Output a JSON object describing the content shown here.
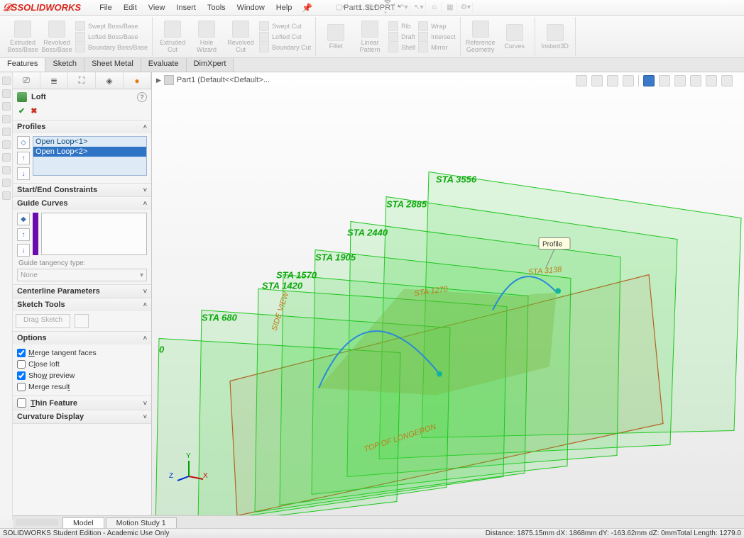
{
  "app": {
    "name": "SOLIDWORKS",
    "title": "Part1.SLDPRT *"
  },
  "menu": {
    "file": "File",
    "edit": "Edit",
    "view": "View",
    "insert": "Insert",
    "tools": "Tools",
    "window": "Window",
    "help": "Help"
  },
  "ribbon": {
    "extruded": "Extruded Boss/Base",
    "revolved": "Revolved Boss/Base",
    "swept": "Swept Boss/Base",
    "lofted": "Lofted Boss/Base",
    "boundary": "Boundary Boss/Base",
    "extrudedCut": "Extruded Cut",
    "holeWizard": "Hole Wizard",
    "revolvedCut": "Revolved Cut",
    "sweptCut": "Swept Cut",
    "loftedCut": "Lofted Cut",
    "boundaryCut": "Boundary Cut",
    "fillet": "Fillet",
    "linear": "Linear Pattern",
    "rib": "Rib",
    "draft": "Draft",
    "shell": "Shell",
    "wrap": "Wrap",
    "intersect": "Intersect",
    "mirror": "Mirror",
    "refGeom": "Reference Geometry",
    "curves": "Curves",
    "instant3d": "Instant3D"
  },
  "tabs": {
    "features": "Features",
    "sketch": "Sketch",
    "sheetMetal": "Sheet Metal",
    "evaluate": "Evaluate",
    "dimxpert": "DimXpert"
  },
  "crumb": "Part1 (Default<<Default>...",
  "feature": {
    "name": "Loft",
    "profilesHdr": "Profiles",
    "profiles": [
      "Open Loop<1>",
      "Open Loop<2>"
    ],
    "startEnd": "Start/End Constraints",
    "guideHdr": "Guide Curves",
    "gtLabel": "Guide tangency type:",
    "gtValue": "None",
    "centerline": "Centerline Parameters",
    "sketchTools": "Sketch Tools",
    "dragSketch": "Drag Sketch",
    "optionsHdr": "Options",
    "opts": {
      "merge": "Merge tangent faces",
      "close": "Close loft",
      "show": "Show preview",
      "result": "Merge result"
    },
    "thin": "Thin Feature",
    "curv": "Curvature Display"
  },
  "scene": {
    "stations": [
      "STA 3556",
      "STA 2885",
      "STA 2440",
      "STA 1905",
      "STA 1570",
      "STA 1420",
      "STA 680"
    ],
    "zero": "0",
    "sideView": "SIDE VIEW",
    "topLong": "TOP OF LONGERON",
    "sta1270": "STA 1270",
    "sta3138": "STA 3138",
    "profileLabel": "Profile"
  },
  "triad": {
    "x": "X",
    "y": "Y",
    "z": "Z"
  },
  "bottomTabs": {
    "model": "Model",
    "motion": "Motion Study 1"
  },
  "status": {
    "left": "SOLIDWORKS Student Edition - Academic Use Only",
    "right": "Distance: 1875.15mm   dX: 1868mm   dY: -163.62mm   dZ: 0mmTotal Length: 1279.0"
  }
}
